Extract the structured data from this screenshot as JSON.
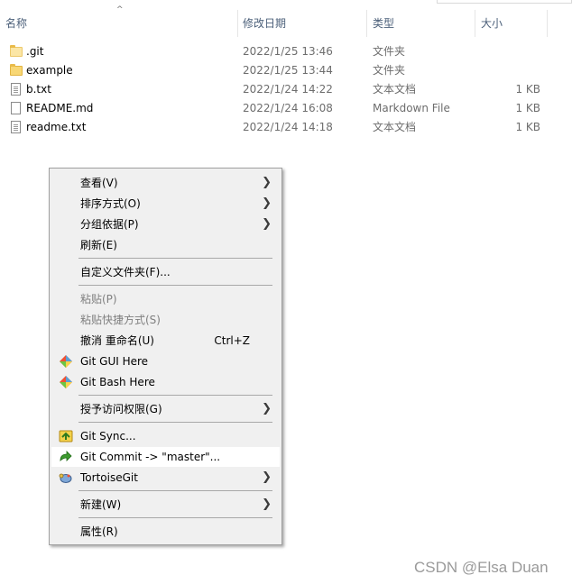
{
  "columns": {
    "name": "名称",
    "modified": "修改日期",
    "type": "类型",
    "size": "大小"
  },
  "files": [
    {
      "name": ".git",
      "date": "2022/1/25 13:46",
      "type": "文件夹",
      "size": "",
      "icon": "folder-icon"
    },
    {
      "name": "example",
      "date": "2022/1/25 13:44",
      "type": "文件夹",
      "size": "",
      "icon": "folder-icon"
    },
    {
      "name": "b.txt",
      "date": "2022/1/24 14:22",
      "type": "文本文档",
      "size": "1 KB",
      "icon": "text-file-icon"
    },
    {
      "name": "README.md",
      "date": "2022/1/24 16:08",
      "type": "Markdown File",
      "size": "1 KB",
      "icon": "markdown-file-icon"
    },
    {
      "name": "readme.txt",
      "date": "2022/1/24 14:18",
      "type": "文本文档",
      "size": "1 KB",
      "icon": "text-file-icon"
    }
  ],
  "menu": {
    "view": "查看(V)",
    "sort_by": "排序方式(O)",
    "group_by": "分组依据(P)",
    "refresh": "刷新(E)",
    "customize_folder": "自定义文件夹(F)...",
    "paste": "粘贴(P)",
    "paste_shortcut": "粘贴快捷方式(S)",
    "undo_rename": "撤消 重命名(U)",
    "undo_shortcut": "Ctrl+Z",
    "git_gui": "Git GUI Here",
    "git_bash": "Git Bash Here",
    "give_access": "授予访问权限(G)",
    "git_sync": "Git Sync...",
    "git_commit": "Git Commit -> \"master\"...",
    "tortoise_git": "TortoiseGit",
    "new": "新建(W)",
    "properties": "属性(R)"
  },
  "watermark": "CSDN @Elsa Duan"
}
